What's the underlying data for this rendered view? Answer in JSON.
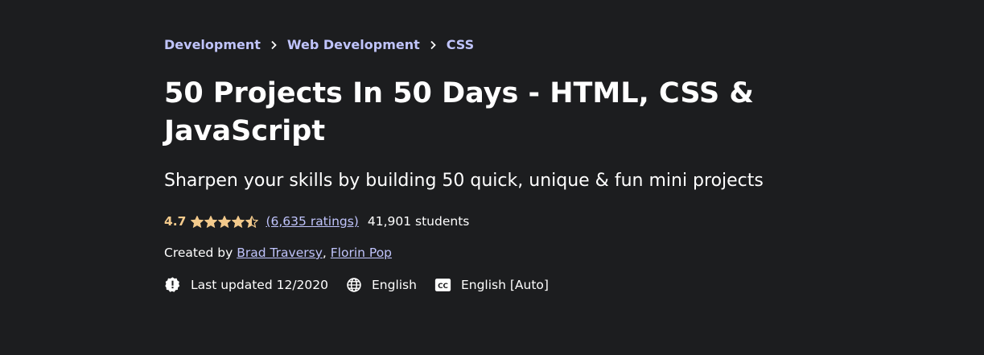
{
  "breadcrumb": {
    "items": [
      "Development",
      "Web Development",
      "CSS"
    ],
    "separator_icon": "chevron-right-icon"
  },
  "course": {
    "title": "50 Projects In 50 Days - HTML, CSS & JavaScript",
    "headline": "Sharpen your skills by building 50 quick, unique & fun mini projects"
  },
  "rating": {
    "value": "4.7",
    "stars_out_of_5": 4.7,
    "ratings_count": "(6,635 ratings)",
    "students": "41,901 students"
  },
  "creators": {
    "prefix": "Created by",
    "names": [
      "Brad Traversy",
      "Florin Pop"
    ],
    "separator": ","
  },
  "meta": {
    "last_updated": "Last updated 12/2020",
    "language": "English",
    "captions": "English [Auto]",
    "icons": [
      "alert-badge-icon",
      "globe-icon",
      "closed-captions-icon"
    ]
  },
  "colors": {
    "background": "#1c1d1f",
    "link": "#c0c4fc",
    "rating": "#f3ca8c",
    "text": "#ffffff"
  }
}
